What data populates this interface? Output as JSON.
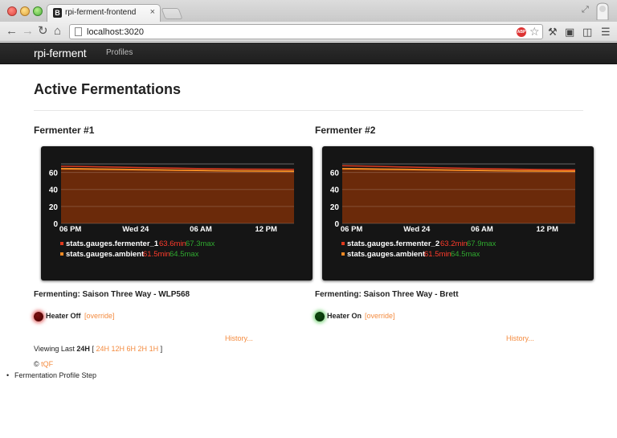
{
  "browser": {
    "tab_title": "rpi-ferment-frontend",
    "tab_favicon": "B",
    "url": "localhost:3020",
    "abp_label": "ABP"
  },
  "navbar": {
    "brand": "rpi-ferment",
    "links": [
      "Profiles"
    ]
  },
  "page": {
    "title": "Active Fermentations"
  },
  "fermenters": [
    {
      "title": "Fermenter #1",
      "status": "Fermenting: Saison Three Way - WLP568",
      "heater_label": "Heater Off",
      "heater_on": false,
      "override_label": "[override]",
      "history_label": "History...",
      "legend": [
        {
          "name": "stats.gauges.fermenter_1",
          "min": "63.6min",
          "max": "67.3max",
          "color": "#e03a1e"
        },
        {
          "name": "stats.gauges.ambient",
          "min": "61.5min",
          "max": "64.5max",
          "color": "#f08a24"
        }
      ]
    },
    {
      "title": "Fermenter #2",
      "status": "Fermenting: Saison Three Way - Brett",
      "heater_label": "Heater On",
      "heater_on": true,
      "override_label": "[override]",
      "history_label": "History...",
      "legend": [
        {
          "name": "stats.gauges.fermenter_2",
          "min": "63.2min",
          "max": "67.9max",
          "color": "#e03a1e"
        },
        {
          "name": "stats.gauges.ambient",
          "min": "61.5min",
          "max": "64.5max",
          "color": "#f08a24"
        }
      ]
    }
  ],
  "chart_data": [
    {
      "type": "area",
      "title": "",
      "xlabel": "",
      "ylabel": "",
      "x_ticks": [
        "06 PM",
        "Wed 24",
        "06 AM",
        "12 PM"
      ],
      "y_ticks": [
        "0",
        "20",
        "40",
        "60"
      ],
      "ylim": [
        0,
        70
      ],
      "x": [
        0,
        1,
        2,
        3,
        4,
        5,
        6,
        7,
        8,
        9,
        10,
        11,
        12
      ],
      "series": [
        {
          "name": "stats.gauges.fermenter_1",
          "color": "#e03a1e",
          "values": [
            67.3,
            67.0,
            66.6,
            66.2,
            65.8,
            65.4,
            65.0,
            64.6,
            64.3,
            64.0,
            63.8,
            63.7,
            63.6
          ]
        },
        {
          "name": "stats.gauges.ambient",
          "color": "#f08a24",
          "values": [
            64.5,
            64.2,
            63.9,
            63.6,
            63.3,
            63.0,
            62.7,
            62.4,
            62.1,
            61.9,
            61.7,
            61.6,
            61.5
          ]
        }
      ]
    },
    {
      "type": "area",
      "title": "",
      "xlabel": "",
      "ylabel": "",
      "x_ticks": [
        "06 PM",
        "Wed 24",
        "06 AM",
        "12 PM"
      ],
      "y_ticks": [
        "0",
        "20",
        "40",
        "60"
      ],
      "ylim": [
        0,
        70
      ],
      "x": [
        0,
        1,
        2,
        3,
        4,
        5,
        6,
        7,
        8,
        9,
        10,
        11,
        12
      ],
      "series": [
        {
          "name": "stats.gauges.fermenter_2",
          "color": "#e03a1e",
          "values": [
            67.9,
            67.5,
            67.0,
            66.5,
            66.0,
            65.5,
            65.0,
            64.6,
            64.2,
            63.8,
            63.5,
            63.3,
            63.2
          ]
        },
        {
          "name": "stats.gauges.ambient",
          "color": "#f08a24",
          "values": [
            64.5,
            64.2,
            63.9,
            63.6,
            63.3,
            63.0,
            62.7,
            62.4,
            62.1,
            61.9,
            61.7,
            61.6,
            61.5
          ]
        }
      ]
    }
  ],
  "viewing": {
    "prefix": "Viewing Last",
    "current": "24H",
    "open_bracket": "[",
    "close_bracket": "]",
    "ranges": [
      "24H",
      "12H",
      "6H",
      "2H",
      "1H"
    ]
  },
  "footer": {
    "copyright": "©",
    "author": "tQF"
  },
  "profile_steps": [
    "Fermentation Profile Step"
  ]
}
